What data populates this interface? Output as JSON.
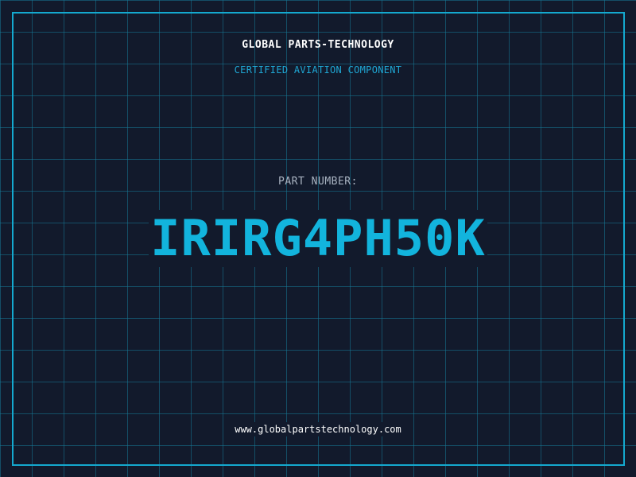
{
  "header": {
    "company": "GLOBAL PARTS-TECHNOLOGY",
    "subtitle": "CERTIFIED AVIATION COMPONENT"
  },
  "part": {
    "label": "PART NUMBER:",
    "number": "IRIRG4PH50K"
  },
  "footer": {
    "url": "www.globalpartstechnology.com"
  },
  "colors": {
    "background": "#121a2c",
    "grid": "#16788f",
    "accent": "#14a9cf",
    "part_number": "#12b4dd",
    "label": "#a9b3c1",
    "text": "#ffffff"
  }
}
